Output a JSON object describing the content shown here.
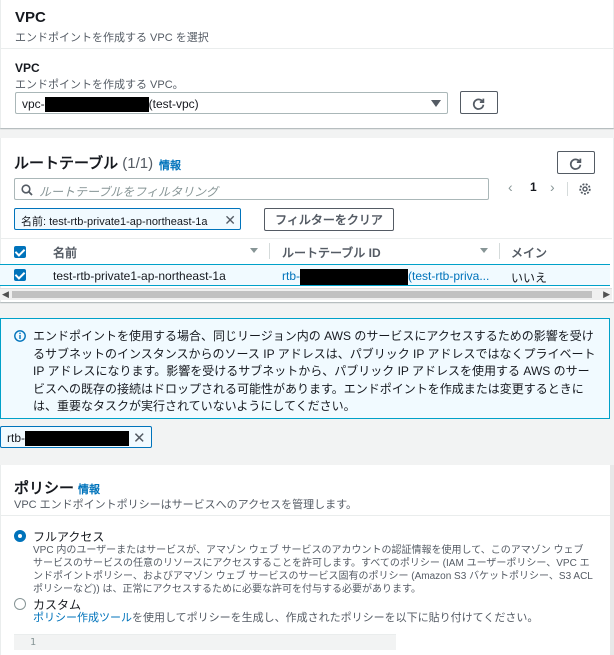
{
  "vpc_section": {
    "title": "VPC",
    "description": "エンドポイントを作成する VPC を選択",
    "field_label": "VPC",
    "field_sublabel": "エンドポイントを作成する VPC。",
    "select_prefix": "vpc-",
    "select_suffix": "(test-vpc)"
  },
  "route_table": {
    "title": "ルートテーブル",
    "count": "(1/1)",
    "info": "情報",
    "filter_placeholder": "ルートテーブルをフィルタリング",
    "page_number": "1",
    "filter_token": "名前: test-rtb-private1-ap-northeast-1a",
    "clear_filter": "フィルターをクリア",
    "columns": [
      "名前",
      "ルートテーブル ID",
      "メイン"
    ],
    "row": {
      "name": "test-rtb-private1-ap-northeast-1a",
      "id_prefix": "rtb-",
      "id_suffix": "(test-rtb-priva...",
      "main": "いいえ"
    }
  },
  "alert": {
    "message": "エンドポイントを使用する場合、同じリージョン内の AWS のサービスにアクセスするための影響を受けるサブネットのインスタンスからのソース IP アドレスは、パブリック IP アドレスではなくプライベート IP アドレスになります。影響を受けるサブネットから、パブリック IP アドレスを使用する AWS のサービスへの既存の接続はドロップされる可能性があります。エンドポイントを作成または変更するときには、重要なタスクが実行されていないようにしてください。"
  },
  "selected_token": {
    "prefix": "rtb-"
  },
  "policy": {
    "title": "ポリシー",
    "info": "情報",
    "description": "VPC エンドポイントポリシーはサービスへのアクセスを管理します。",
    "full_access_label": "フルアクセス",
    "full_access_desc": "VPC 内のユーザーまたはサービスが、アマゾン ウェブ サービスのアカウントの認証情報を使用して、このアマゾン ウェブ サービスのサービスの任意のリソースにアクセスすることを許可します。すべてのポリシー (IAM ユーザーポリシー、VPC エンドポイントポリシー、およびアマゾン ウェブ サービスのサービス固有のポリシー (Amazon S3 バケットポリシー、S3 ACL ポリシーなど)) は、正常にアクセスするために必要な許可を付与する必要があります。",
    "custom_label": "カスタム",
    "custom_link": "ポリシー作成ツール",
    "custom_desc": "を使用してポリシーを生成し、作成されたポリシーを以下に貼り付けてください。",
    "editor_line": "1"
  },
  "colors": {
    "accent": "#0073bb",
    "alert_border": "#00a1c9",
    "alert_bg": "#f1faff"
  },
  "icons": [
    "refresh-icon",
    "search-icon",
    "settings-icon",
    "info-circle-icon",
    "close-icon",
    "chevron-left-icon",
    "chevron-right-icon",
    "caret-down-icon"
  ]
}
